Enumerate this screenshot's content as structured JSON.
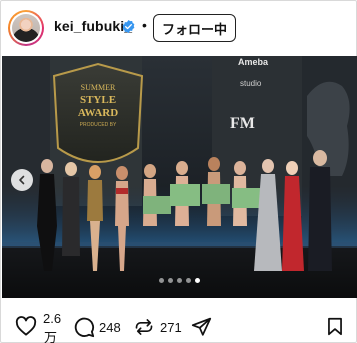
{
  "header": {
    "username": "kei_fubuki_",
    "separator": "•",
    "follow_label": "フォロー中"
  },
  "photo": {
    "stage_text_award_line1": "SUMMER",
    "stage_text_award_line2": "STYLE",
    "stage_text_award_line3": "AWARD",
    "stage_text_award_line4": "PRODUCED BY",
    "stage_text_sponsor1": "Ameba",
    "stage_text_sponsor2": "studio",
    "stage_text_sponsor3": "FM",
    "carousel_total": 5,
    "carousel_active": 5
  },
  "actions": {
    "likes_line1": "2.6",
    "likes_line2": "万",
    "comments": "248",
    "reposts": "271"
  },
  "colors": {
    "verified": "#3897f0",
    "stage_bg": "#1f242b"
  }
}
